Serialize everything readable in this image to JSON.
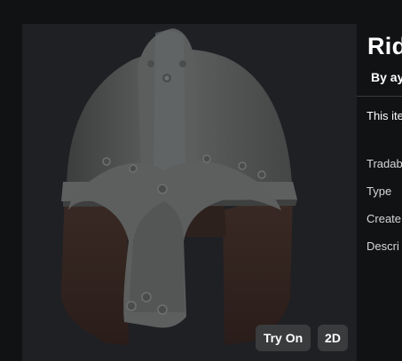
{
  "item": {
    "title": "Rid",
    "byline": "By ay",
    "description": "This ite"
  },
  "preview": {
    "image_subject": "helmet-image",
    "buttons": {
      "try_on_label": "Try On",
      "view_2d_label": "2D"
    }
  },
  "details": {
    "labels": [
      "Tradab",
      "Type",
      "Create",
      "Descri"
    ]
  },
  "colors": {
    "page_bg": "#111214",
    "preview_bg": "#1f2024",
    "button_bg": "#393b3d",
    "text": "#ffffff"
  }
}
